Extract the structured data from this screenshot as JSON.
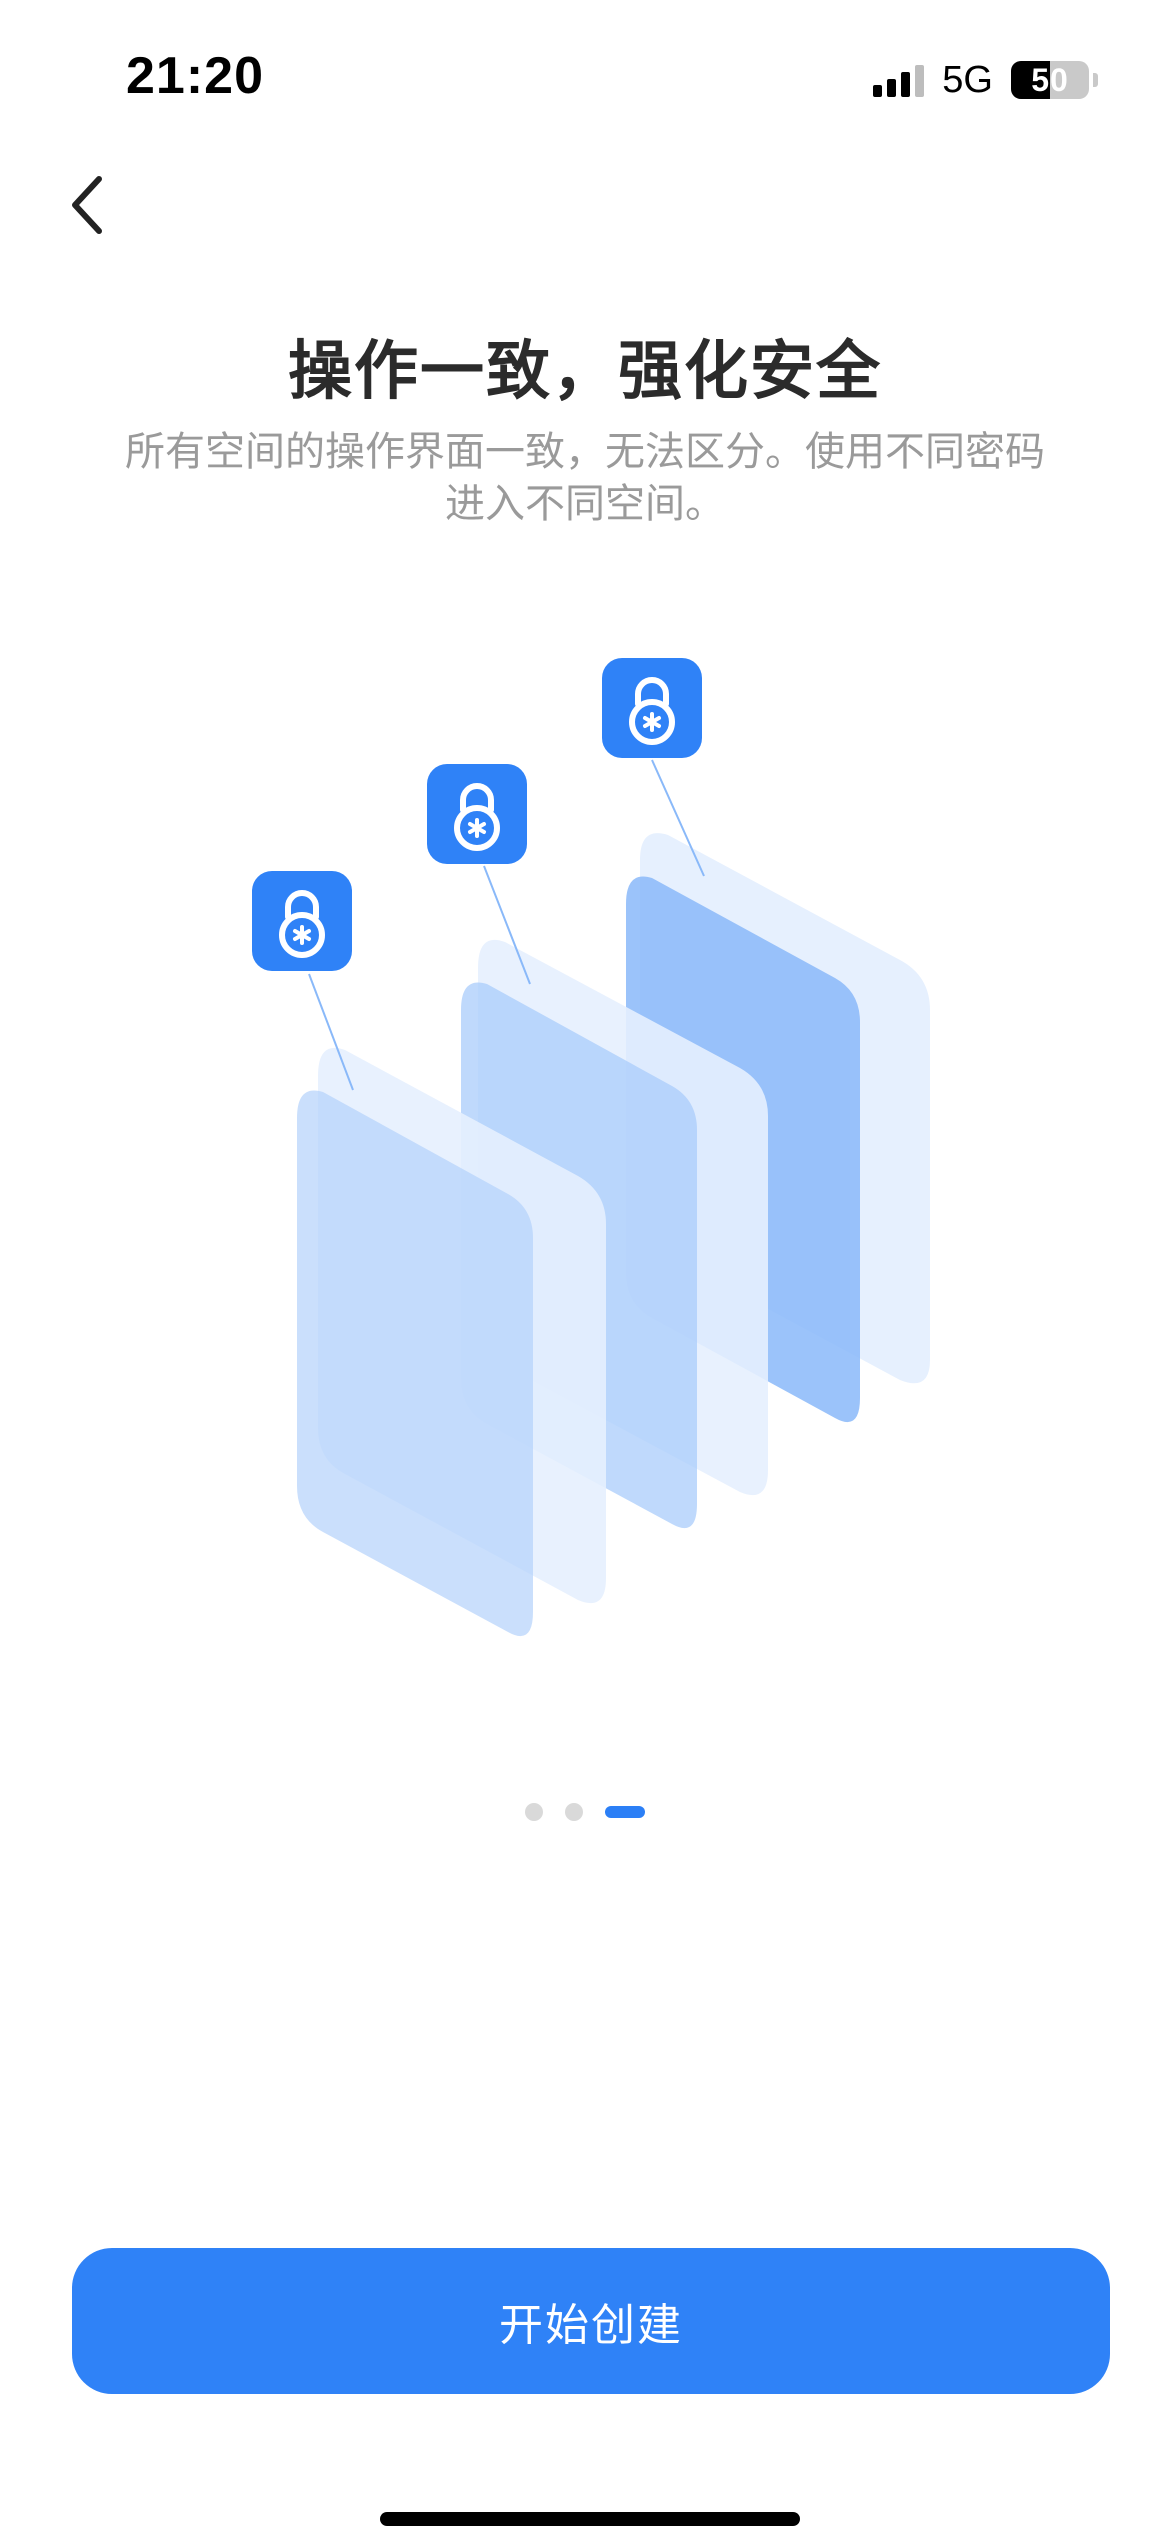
{
  "status_bar": {
    "time": "21:20",
    "network": "5G",
    "battery_level": "50",
    "battery_fraction": 0.5
  },
  "nav": {
    "back_icon": "chevron-left-icon"
  },
  "content": {
    "title": "操作一致，强化安全",
    "subtitle_line1": "所有空间的操作界面一致，无法区分。使用不同密码",
    "subtitle_line2": "进入不同空间。"
  },
  "illustration": {
    "icons": [
      "lock-icon",
      "lock-icon",
      "lock-icon"
    ],
    "colors": {
      "lock_badge": "#2f82f7",
      "panel_light": "#dbe9fd",
      "panel_mid": "#a9ccfb",
      "panel_dark": "#8ab9f9"
    }
  },
  "pagination": {
    "total": 3,
    "active_index": 2
  },
  "cta": {
    "label": "开始创建"
  },
  "colors": {
    "accent": "#2f82f7",
    "title": "#2b2b2b",
    "subtitle": "#9a9a9a"
  }
}
